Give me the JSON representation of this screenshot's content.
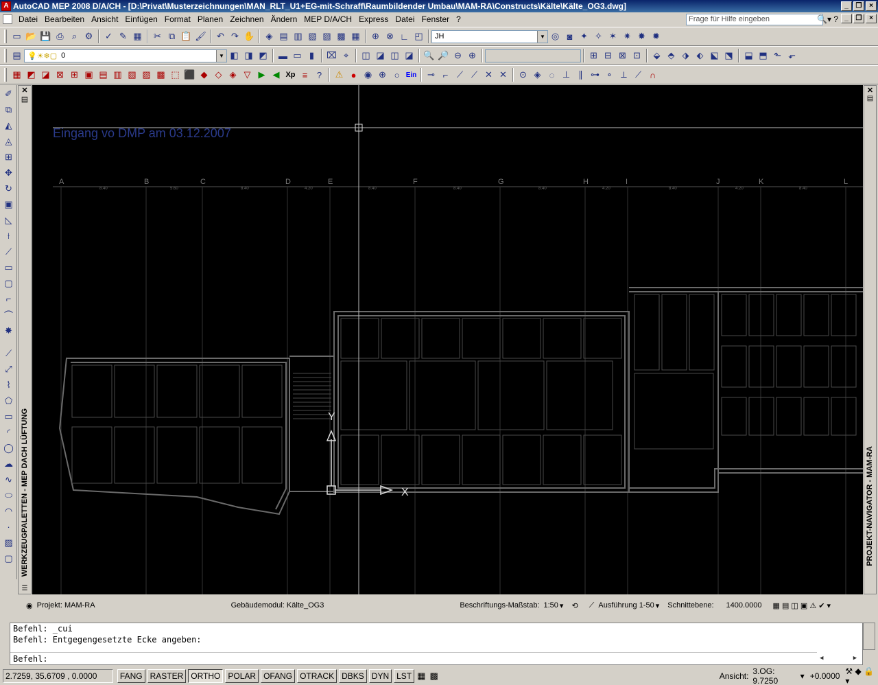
{
  "window": {
    "title": "AutoCAD MEP 2008 D/A/CH - [D:\\Privat\\Musterzeichnungen\\MAN_RLT_U1+EG-mit-Schraff\\Raumbildender Umbau\\MAM-RA\\Constructs\\Kälte\\Kälte_OG3.dwg]"
  },
  "menu": {
    "items": [
      "Datei",
      "Bearbeiten",
      "Ansicht",
      "Einfügen",
      "Format",
      "Planen",
      "Zeichnen",
      "Ändern",
      "MEP D/A/CH",
      "Express",
      "Datei",
      "Fenster",
      "?"
    ],
    "help_placeholder": "Frage für Hilfe eingeben"
  },
  "toolbar": {
    "user_combo": "JH",
    "layer_combo": "0"
  },
  "palettes": {
    "left_title": "WERKZEUGPALETTEN - MEP DACH LÜFTUNG",
    "right_title": "PROJEKT-NAVIGATOR - MAM-RA"
  },
  "drawing": {
    "annotation": "Eingang vo DMP am 03.12.2007",
    "grid_labels": [
      "A",
      "B",
      "C",
      "D",
      "E",
      "F",
      "G",
      "H",
      "I",
      "J",
      "K",
      "L"
    ],
    "dim_values": [
      "8.40",
      "5.60",
      "8.40",
      "4.20",
      "8.40",
      "8.40",
      "8.40",
      "4.20",
      "8.40",
      "4.20",
      "8.40"
    ],
    "ucs_x": "X",
    "ucs_y": "Y"
  },
  "status": {
    "project": "Projekt: MAM-RA",
    "building": "Gebäudemodul: Kälte_OG3",
    "scale_label": "Beschriftungs-Maßstab:",
    "scale_value": "1:50",
    "detail": "Ausführung 1-50",
    "cut_label": "Schnittebene:",
    "cut_value": "1400.0000"
  },
  "command": {
    "lines": [
      "Befehl: _cui",
      "Befehl: Entgegengesetzte Ecke angeben:"
    ],
    "prompt": "Befehl:"
  },
  "statusbar": {
    "coords": "2.7259,  35.6709 , 0.0000",
    "modes": [
      "FANG",
      "RASTER",
      "ORTHO",
      "POLAR",
      "OFANG",
      "OTRACK",
      "DBKS",
      "DYN",
      "LST"
    ],
    "active_mode": "ORTHO",
    "view_label": "Ansicht:",
    "view_value": "3.OG: 9.7250",
    "offset": "+0.0000"
  }
}
